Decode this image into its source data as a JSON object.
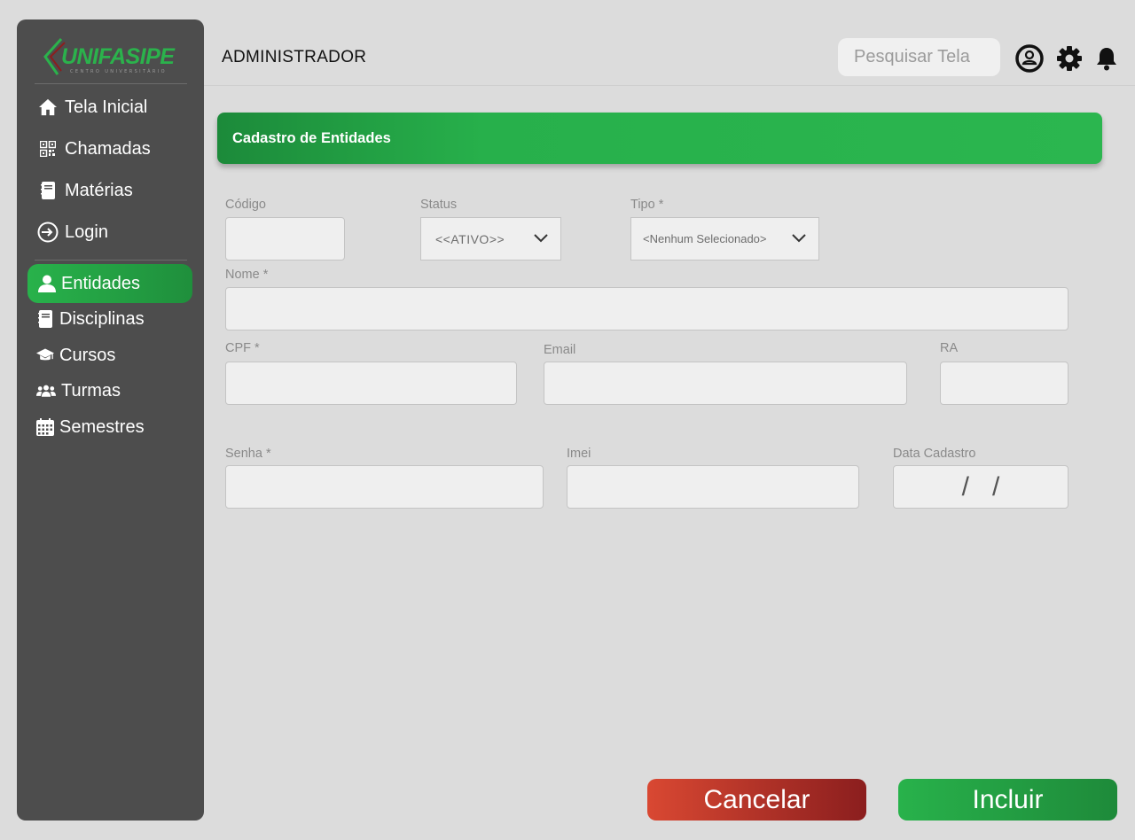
{
  "brand": {
    "name": "UNIFASIPE",
    "subtitle": "CENTRO UNIVERSITÁRIO",
    "color": "#2bb24c"
  },
  "sidebar": {
    "items": [
      {
        "label": "Tela Inicial",
        "icon": "home-icon"
      },
      {
        "label": "Chamadas",
        "icon": "qr-code-icon"
      },
      {
        "label": "Matérias",
        "icon": "notebook-icon"
      },
      {
        "label": "Login",
        "icon": "login-icon"
      },
      {
        "label": "Entidades",
        "icon": "user-icon",
        "active": true
      },
      {
        "label": "Disciplinas",
        "icon": "notebook-icon"
      },
      {
        "label": "Cursos",
        "icon": "graduation-cap-icon"
      },
      {
        "label": "Turmas",
        "icon": "users-icon"
      },
      {
        "label": "Semestres",
        "icon": "calendar-icon"
      }
    ]
  },
  "header": {
    "title": "ADMINISTRADOR",
    "search_placeholder": "Pesquisar Tela",
    "icons": [
      "user-circle-icon",
      "gear-icon",
      "bell-icon"
    ]
  },
  "banner": {
    "title": "Cadastro de Entidades"
  },
  "form": {
    "codigo": {
      "label": "Código",
      "value": ""
    },
    "status": {
      "label": "Status",
      "value": "<<ATIVO>>"
    },
    "tipo": {
      "label": "Tipo *",
      "value": "<Nenhum Selecionado>"
    },
    "nome": {
      "label": "Nome *",
      "value": ""
    },
    "cpf": {
      "label": "CPF *",
      "value": ""
    },
    "email": {
      "label": "Email",
      "value": ""
    },
    "ra": {
      "label": "RA",
      "value": ""
    },
    "senha": {
      "label": "Senha *",
      "value": ""
    },
    "imei": {
      "label": "Imei",
      "value": ""
    },
    "data_cadastro": {
      "label": "Data Cadastro",
      "separator": "/"
    }
  },
  "actions": {
    "cancel": "Cancelar",
    "include": "Incluir"
  },
  "colors": {
    "accent": "#28b24b",
    "danger": "#d94832",
    "sidebar_bg": "#4d4d4d",
    "page_bg": "#dcdcdc"
  }
}
